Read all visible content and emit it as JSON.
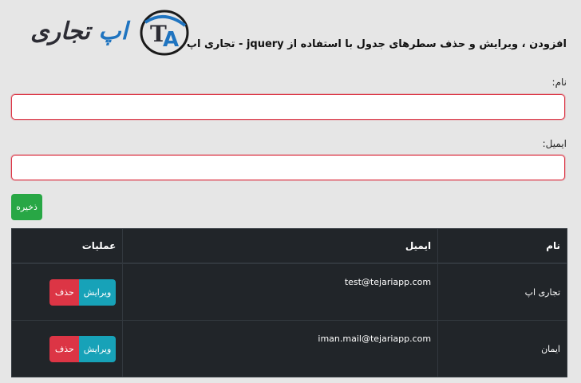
{
  "logo": {
    "word1": "اپ",
    "word2": "تجاری",
    "mark_letters": "TA",
    "mark_colors": {
      "ring": "#1a1a1a",
      "accent": "#1f74c0"
    }
  },
  "page_title": "افزودن ، ویرایش و حذف سطرهای جدول با استفاده از jquery - تجاری اپ",
  "form": {
    "name_label": "نام:",
    "name_value": "",
    "email_label": "ایمیل:",
    "email_value": "",
    "save_label": "ذخیره"
  },
  "table": {
    "headers": {
      "name": "نام",
      "email": "ایمیل",
      "ops": "عملیات"
    },
    "rows": [
      {
        "name": "تجاری اپ",
        "email": "test@tejariapp.com",
        "edit_label": "ویرایش",
        "delete_label": "حذف"
      },
      {
        "name": "ایمان",
        "email": "iman.mail@tejariapp.com",
        "edit_label": "ویرایش",
        "delete_label": "حذف"
      }
    ]
  },
  "colors": {
    "background": "#e6e6e6",
    "input_border": "#dc3545",
    "save": "#28a745",
    "edit": "#17a2b8",
    "delete": "#dc3545",
    "table_bg": "#212529"
  }
}
